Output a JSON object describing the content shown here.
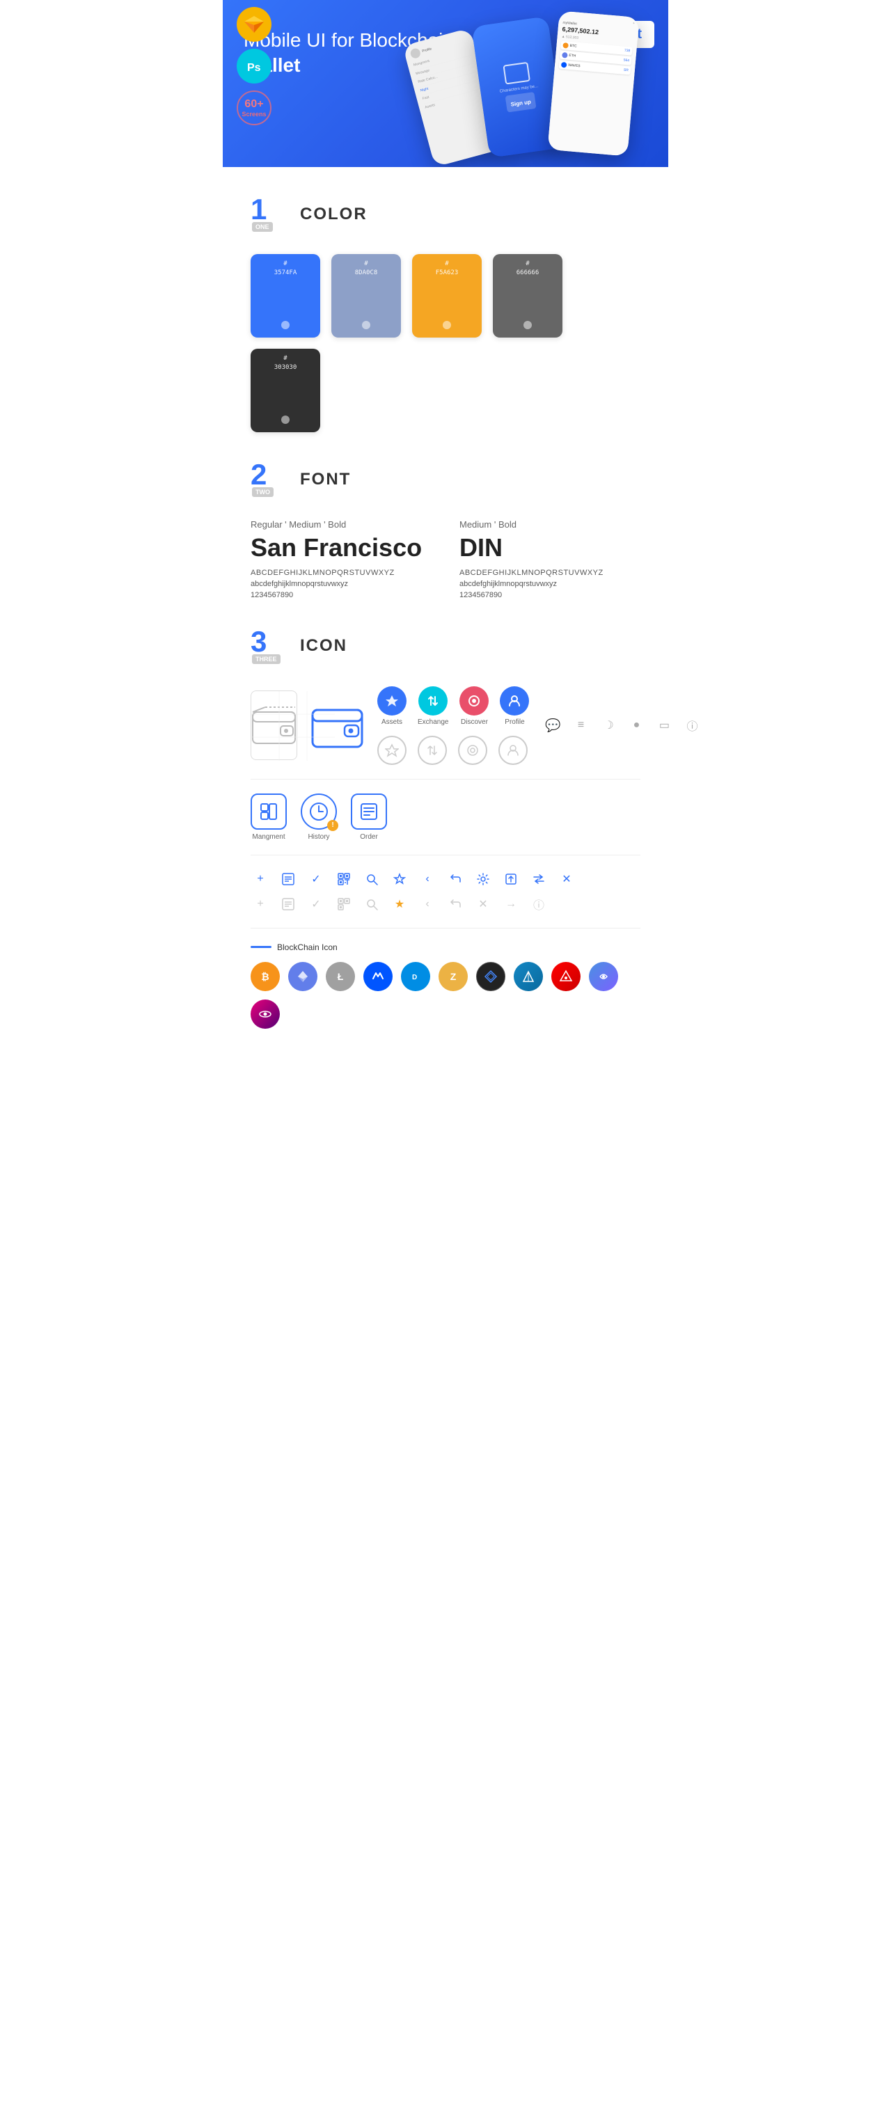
{
  "hero": {
    "title_normal": "Mobile UI for Blockchain ",
    "title_bold": "Wallet",
    "badge": "UI Kit",
    "badges": [
      {
        "type": "sketch",
        "label": "Sk"
      },
      {
        "type": "ps",
        "label": "Ps"
      },
      {
        "type": "screens",
        "num": "60+",
        "text": "Screens"
      }
    ]
  },
  "sections": {
    "color": {
      "num": "1",
      "word": "ONE",
      "title": "COLOR",
      "swatches": [
        {
          "hex": "#3574FA",
          "label": "#\n3574FA",
          "textColor": "#fff"
        },
        {
          "hex": "#8DA0C8",
          "label": "#\n8DA0C8",
          "textColor": "#fff"
        },
        {
          "hex": "#F5A623",
          "label": "#\nF5A623",
          "textColor": "#fff"
        },
        {
          "hex": "#666666",
          "label": "#\n666666",
          "textColor": "#fff"
        },
        {
          "hex": "#303030",
          "label": "#\n303030",
          "textColor": "#fff"
        }
      ]
    },
    "font": {
      "num": "2",
      "word": "TWO",
      "title": "FONT",
      "fonts": [
        {
          "weights": "Regular ' Medium ' Bold",
          "name": "San Francisco",
          "uppercase": "ABCDEFGHIJKLMNOPQRSTUVWXYZ",
          "lowercase": "abcdefghijklmnopqrstuvwxyz",
          "numbers": "1234567890",
          "style": "san-francisco"
        },
        {
          "weights": "Medium ' Bold",
          "name": "DIN",
          "uppercase": "ABCDEFGHIJKLMNOPQRSTUVWXYZ",
          "lowercase": "abcdefghijklmnopqrstuvwxyz",
          "numbers": "1234567890",
          "style": "din"
        }
      ]
    },
    "icon": {
      "num": "3",
      "word": "THREE",
      "title": "ICON",
      "labeled_icons": [
        {
          "label": "Assets",
          "type": "diamond"
        },
        {
          "label": "Exchange",
          "type": "exchange"
        },
        {
          "label": "Discover",
          "type": "discover"
        },
        {
          "label": "Profile",
          "type": "profile"
        }
      ],
      "app_icons": [
        {
          "label": "Mangment",
          "type": "management"
        },
        {
          "label": "History",
          "type": "history"
        },
        {
          "label": "Order",
          "type": "order"
        }
      ],
      "small_icons_row1_blue": [
        "+",
        "☷",
        "✓",
        "⊞",
        "⌕",
        "☆",
        "‹",
        "⟨",
        "⚙",
        "⬒",
        "⇄",
        "✕"
      ],
      "small_icons_row2_gray": [
        "+",
        "☷",
        "✓",
        "⊞",
        "⌕",
        "☆",
        "‹",
        "⟨",
        "✕",
        "→",
        "ℹ"
      ],
      "blockchain_label": "BlockChain Icon",
      "crypto_icons": [
        {
          "symbol": "₿",
          "class": "crypto-btc"
        },
        {
          "symbol": "Ξ",
          "class": "crypto-eth"
        },
        {
          "symbol": "Ł",
          "class": "crypto-ltc"
        },
        {
          "symbol": "◆",
          "class": "crypto-waves"
        },
        {
          "symbol": "D",
          "class": "crypto-dash"
        },
        {
          "symbol": "Z",
          "class": "crypto-zcash"
        },
        {
          "symbol": "◈",
          "class": "crypto-grid"
        },
        {
          "symbol": "▲",
          "class": "crypto-strat"
        },
        {
          "symbol": "Ā",
          "class": "crypto-ark"
        },
        {
          "symbol": "◉",
          "class": "crypto-band"
        },
        {
          "symbol": "•",
          "class": "crypto-dot"
        }
      ]
    }
  }
}
